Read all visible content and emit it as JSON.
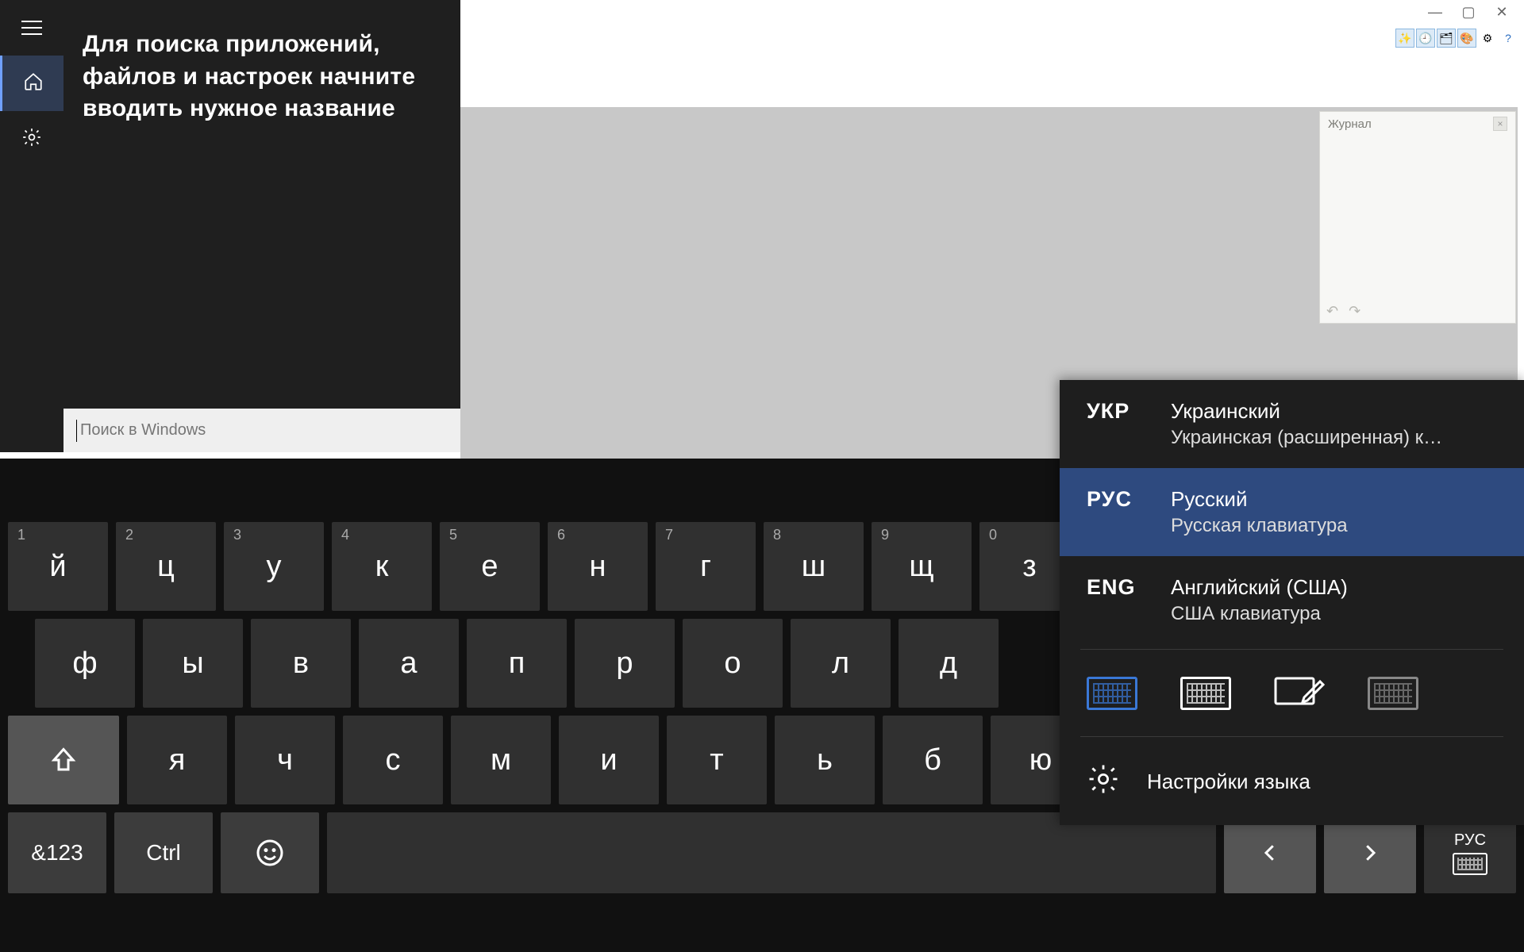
{
  "app": {
    "history_panel_title": "Журнал"
  },
  "search": {
    "hint": "Для поиска приложений, файлов и настроек начните вводить нужное название",
    "placeholder": "Поиск в Windows",
    "value": ""
  },
  "osk": {
    "row1": [
      {
        "sup": "1",
        "label": "й"
      },
      {
        "sup": "2",
        "label": "ц"
      },
      {
        "sup": "3",
        "label": "у"
      },
      {
        "sup": "4",
        "label": "к"
      },
      {
        "sup": "5",
        "label": "е"
      },
      {
        "sup": "6",
        "label": "н"
      },
      {
        "sup": "7",
        "label": "г"
      },
      {
        "sup": "8",
        "label": "ш"
      },
      {
        "sup": "9",
        "label": "щ"
      },
      {
        "sup": "0",
        "label": "з"
      }
    ],
    "row2": [
      {
        "label": "ф"
      },
      {
        "label": "ы"
      },
      {
        "label": "в"
      },
      {
        "label": "а"
      },
      {
        "label": "п"
      },
      {
        "label": "р"
      },
      {
        "label": "о"
      },
      {
        "label": "л"
      },
      {
        "label": "д"
      }
    ],
    "row3": [
      {
        "label": "я"
      },
      {
        "label": "ч"
      },
      {
        "label": "с"
      },
      {
        "label": "м"
      },
      {
        "label": "и"
      },
      {
        "label": "т"
      },
      {
        "label": "ь"
      },
      {
        "label": "б"
      },
      {
        "label": "ю"
      }
    ],
    "sym_label": "&123",
    "ctrl_label": "Ctrl",
    "lang_label": "РУС"
  },
  "lang_picker": {
    "items": [
      {
        "abbr": "УКР",
        "name": "Украинский",
        "layout": "Украинская (расширенная) к…",
        "selected": false
      },
      {
        "abbr": "РУС",
        "name": "Русский",
        "layout": "Русская клавиатура",
        "selected": true
      },
      {
        "abbr": "ENG",
        "name": "Английский (США)",
        "layout": "США клавиатура",
        "selected": false
      }
    ],
    "settings_label": "Настройки языка"
  }
}
